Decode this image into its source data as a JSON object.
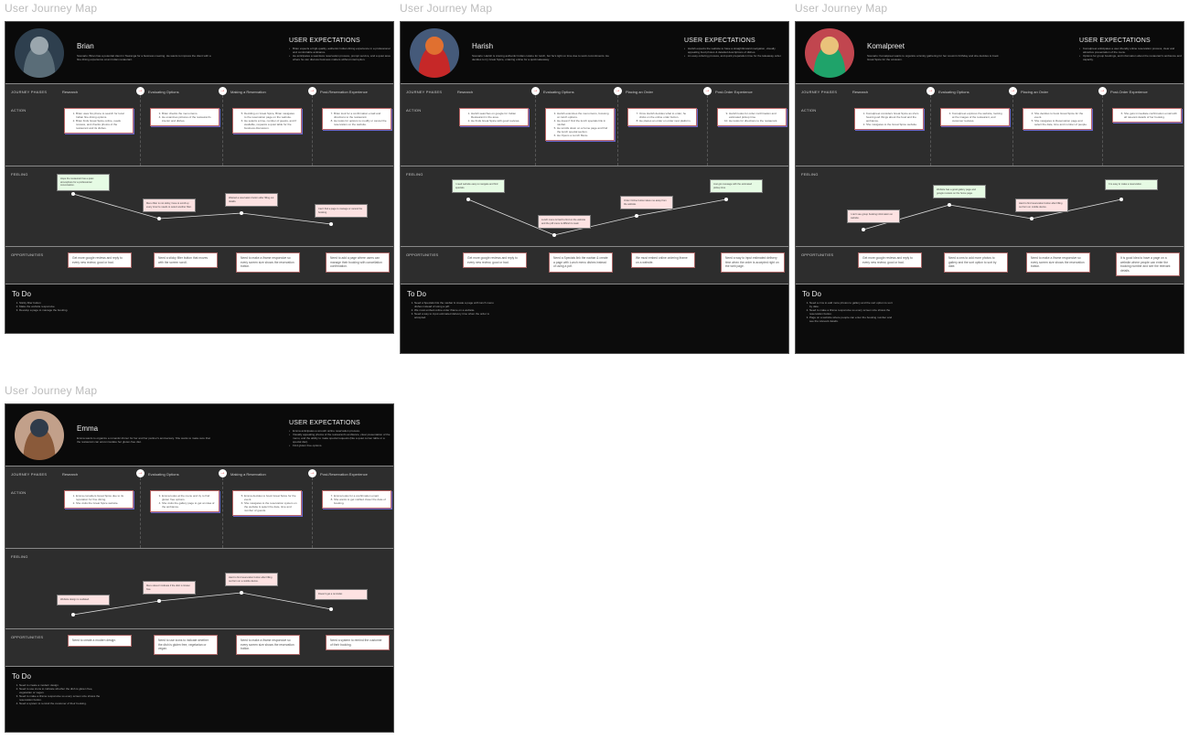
{
  "board_label": "User Journey Map",
  "row_labels": {
    "phases": "JOURNEY PHASES",
    "action": "ACTION",
    "feeling": "FEELING",
    "opportunities": "OPPORTUNITIES"
  },
  "expectations_title": "USER EXPECTATIONS",
  "todo_title": "To Do",
  "arrow_glyph": "→",
  "colors": {
    "positive_note": "#e6fbe4",
    "negative_note": "#fde2e2",
    "arrow": "#dd3333",
    "header_bg": "#0a0a0a",
    "body_bg": "#2d2d2d"
  },
  "boards": [
    {
      "persona": "Brian",
      "avatar_colors": [
        "#5a6d78",
        "#2e3f4e",
        "#9aa6ad"
      ],
      "scenario": "Scenario: Brian has a potential client in Tauranga for a business meeting. He wants to impress the client with a fine dining experience at an Indian restaurant.",
      "expectations": [
        "Brian expects a high-quality, authentic Indian dining experience in a professional and comfortable ambiance.",
        "He anticipates a seamless reservation process, prompt service, and a quiet area where he can discuss business matters without interruption."
      ],
      "phases": [
        "Research",
        "Evaluating Options",
        "Making a Reservation",
        "Post-Reservation Experience"
      ],
      "actions": [
        [
          "Brian uses his phone to search for local Indian fine dining options.",
          "Brian finds Great Spice online, reads reviews, and checks photos of the restaurant and its dishes."
        ],
        [
          "Brian checks the menu items.",
          "He examines pictures of the restaurant's interior and dishes."
        ],
        [
          "Deciding on Great Spice, Brian navigates to the reservation page on the website.",
          "He selects a time, number of guests, and if available, requests a quiet table for the business discussion."
        ],
        [
          "Brian look for a confirmation email and directions to the restaurant.",
          "He looks for options to modify or cancel the reservation on the website."
        ]
      ],
      "action_start": [
        1,
        3,
        5,
        7
      ],
      "feelings": [
        {
          "text": "Hope the restaurant has a quiet atmosphere for a professional conversation.",
          "mood": "positive",
          "level": 0.8
        },
        {
          "text": "Menu filter is not sticky; have to scroll up every time he needs to select another filter.",
          "mood": "negative",
          "level": 0.35
        },
        {
          "text": "Wanted a reservation button after filling out details.",
          "mood": "negative",
          "level": 0.45
        },
        {
          "text": "Can't find a page to manage or cancel the booking.",
          "mood": "negative",
          "level": 0.25
        }
      ],
      "opportunities": [
        "Get more google reviews and reply to every new review, good or bad.",
        "Need a sticky filter button that moves with the screen scroll.",
        "Need to make a iframe responsive so every screen size shows the reservation button.",
        "Need to add a page where users can manage their booking with cancellation confirmation."
      ],
      "todo": [
        "Sticky filter button",
        "Make the website responsive",
        "Develop a page to manage the booking."
      ]
    },
    {
      "persona": "Harish",
      "avatar_colors": [
        "#c62828",
        "#455a7a",
        "#e07030"
      ],
      "scenario": "Scenario: Harish is craving authentic Indian cuisine for lunch, but he's tight on time due to work commitments. He decides to try Great Spice, ordering online for a quick takeaway.",
      "expectations": [
        "Harish expects the website to have a straightforward navigation, visually appealing food photos & detailed descriptions of dishes.",
        "An easy ordering process, and quick preparation time for the takeaway order."
      ],
      "phases": [
        "Research",
        "Evaluating Options",
        "Placing an Order",
        "Post-Order Experience"
      ],
      "actions": [
        [
          "Harish searches on google for Indian Restaurant in the area.",
          "He finds Great Spice with good reviews."
        ],
        [
          "Harish examines the menu items, focusing on lunch options.",
          "He doesn't find the lunch specials link in navbar.",
          "He scrolls down on a home page and find the lunch special section.",
          "He Opens a Lunch Menu."
        ],
        [
          "Once Harish decides what to order, he clicks on the online order button.",
          "He places an order on order next platform."
        ],
        [
          "Harish looks for order confirmation and estimated pickup time.",
          "He looks for directions to the restaurant."
        ]
      ],
      "action_start": [
        1,
        3,
        7,
        9
      ],
      "feelings": [
        {
          "text": "I need website easy to navigate and find specials.",
          "mood": "positive",
          "level": 0.7
        },
        {
          "text": "Lunch menu is hard to find on the website and the pdf menu is difficult to read.",
          "mood": "negative",
          "level": 0.05
        },
        {
          "text": "Order Online button takes me away from the website.",
          "mood": "negative",
          "level": 0.4
        },
        {
          "text": "Just got message with the estimated pickup time.",
          "mood": "positive",
          "level": 0.7
        }
      ],
      "opportunities": [
        "Get more google reviews and reply to every new review, good or bad.",
        "Need a Specials link the navbar & create a page with Lunch menu dishes instead of using a pdf.",
        "We must embed online ordering iframe on a website.",
        "Need a way to input estimated delivery time when the order is accepted right on the web page."
      ],
      "todo": [
        "Need a Specials link the navbar & create a page with lunch menu dishes instead of using a pdf.",
        "We must embed online order iframe on a website.",
        "Need a way to input estimated delivery time when the order is accepted."
      ]
    },
    {
      "persona": "Komalpreet",
      "avatar_colors": [
        "#1fa36a",
        "#c1464f",
        "#e9c27a"
      ],
      "scenario": "Scenario: Komalpreet wants to organize a family gathering for her cousin's birthday and she decides to book Great Spice for the occasion.",
      "expectations": [
        "Komalpreet anticipates a user-friendly online reservation process, clear and attractive presentation of the menu.",
        "Options for group bookings, and information about the restaurant's ambience and capacity."
      ],
      "phases": [
        "Research",
        "Evaluating Options",
        "Placing an Order",
        "Post-Order Experience"
      ],
      "actions": [
        [
          "Komalpreet considers Great Spice as she's heard good things about the food and the ambiance.",
          "She navigates to the Great Spice website."
        ],
        [
          "Komalpreet explores the website, looking at the images of the restaurant, and customer reviews."
        ],
        [
          "She decides to book Great Spice for the event.",
          "She navigates to Reservation page and select the date, time and number of people."
        ],
        [
          "She gets immediate confirmation email with all relevant details of her booking."
        ]
      ],
      "action_start": [
        1,
        3,
        4,
        6
      ],
      "feelings": [
        {
          "text": "I can't see group booking information on website.",
          "mood": "negative",
          "level": 0.15
        },
        {
          "text": "Website has a good gallery page and google reviews on the home page.",
          "mood": "positive",
          "level": 0.6
        },
        {
          "text": "Hard to find reservation button after filling out form on mobile device.",
          "mood": "negative",
          "level": 0.35
        },
        {
          "text": "It is easy to make a reservation.",
          "mood": "positive",
          "level": 0.7
        }
      ],
      "opportunities": [
        "Get more google reviews and reply to every new review, good or bad.",
        "Need a cms to add more photos to gallery and the sort option to sort by date.",
        "Need to make a iframe responsive so every screen size shows the reservation button.",
        "It is good idea to have a page on a website where people can enter the booking number and see the relevant details."
      ],
      "todo": [
        "Need a cms to add more photos to gallery and the sort option to sort by date.",
        "Need to make a iframe responsive so every screen size shows the reservation button.",
        "Page on a website where people can enter the booking number and see the relevant details."
      ]
    },
    {
      "persona": "Emma",
      "avatar_colors": [
        "#8a5a3a",
        "#c2a08a",
        "#2f3b4a"
      ],
      "scenario": "Emma wants to organize a romantic dinner for her and her partner's anniversary. She wants to make sure that the restaurant can accommodate her gluten-free diet.",
      "expectations": [
        "Emma anticipates a smooth online reservation process.",
        "Visually appealing photos of the restaurant's ambiance, clear presentation of the menu, and the ability to make special requests (like a quiet corner table or a special diet).",
        "Find gluten free options."
      ],
      "phases": [
        "Research",
        "Evaluating Options",
        "Making a Reservation",
        "Post-Reservation Experience"
      ],
      "actions": [
        [
          "Emma considers Great Spice due to its reputation for fine dining.",
          "She visits the Great Spice website."
        ],
        [
          "Emma looks at the menu and try to find gluten free options.",
          "She visits the gallery page to get an idea of the ambiance."
        ],
        [
          "Emma decides to book Great Spice for the event.",
          "She navigates to the reservation system on the website & select the date, time and number of guests."
        ],
        [
          "Emma looks for a confirmation email.",
          "She wants to get notified closer the date of booking."
        ]
      ],
      "action_start": [
        1,
        3,
        5,
        7
      ],
      "feelings": [
        {
          "text": "Website design is outdated.",
          "mood": "negative",
          "level": 0.1
        },
        {
          "text": "Menu doesn't indicate if the dish is Gluten free.",
          "mood": "negative",
          "level": 0.35
        },
        {
          "text": "Hard to find reservation button after filling out form on a mobile device.",
          "mood": "negative",
          "level": 0.5
        },
        {
          "text": "Doesn't get a reminder.",
          "mood": "negative",
          "level": 0.2
        }
      ],
      "opportunities": [
        "Need to create a modern design.",
        "Need to use icons to indicate whether the dish is gluten free, vegetarian or vegan.",
        "Need to make a iframe responsive so every screen size shows the reservation button.",
        "Need a system to remind the customer of their booking."
      ],
      "todo": [
        "Need to create a modern design.",
        "Need to use icons to indicate whether the dish is gluten free, vegetarian or vegan.",
        "Need to make a iframe responsive so every screen size shows the reservation button.",
        "Need a system to remind the customer of their booking."
      ]
    }
  ]
}
